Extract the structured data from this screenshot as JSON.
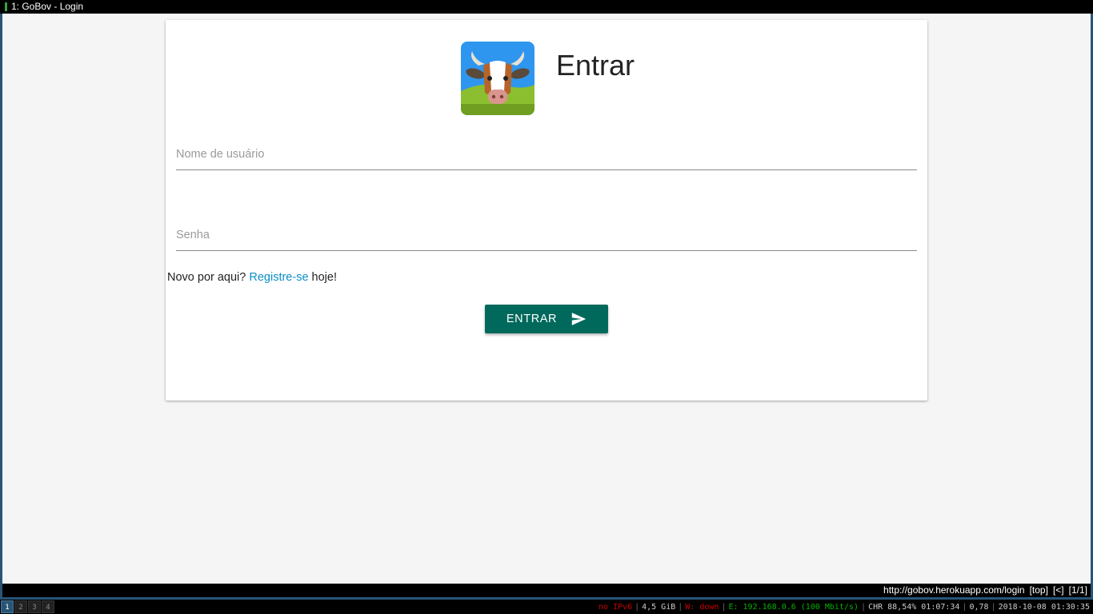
{
  "window": {
    "title": "1: GoBov - Login"
  },
  "login": {
    "heading": "Entrar",
    "username_placeholder": "Nome de usuário",
    "password_placeholder": "Senha",
    "register_prefix": "Novo por aqui? ",
    "register_link": "Registre-se",
    "register_suffix": " hoje!",
    "submit_label": "ENTRAR",
    "submit_color": "#00695c",
    "link_color": "#0b8fc7"
  },
  "browser_status": {
    "url": "http://gobov.herokuapp.com/login",
    "scroll": "[top]",
    "history": "[<]",
    "tabs": "[1/1]"
  },
  "i3bar": {
    "workspaces": [
      "1",
      "2",
      "3",
      "4"
    ],
    "ipv6": "no IPv6",
    "disk": "4,5 GiB",
    "wifi": "W: down",
    "ethernet": "E: 192.168.0.6 (100 Mbit/s)",
    "battery": "CHR 88,54% 01:07:34",
    "load": "0,78",
    "datetime": "2018-10-08 01:30:35"
  }
}
